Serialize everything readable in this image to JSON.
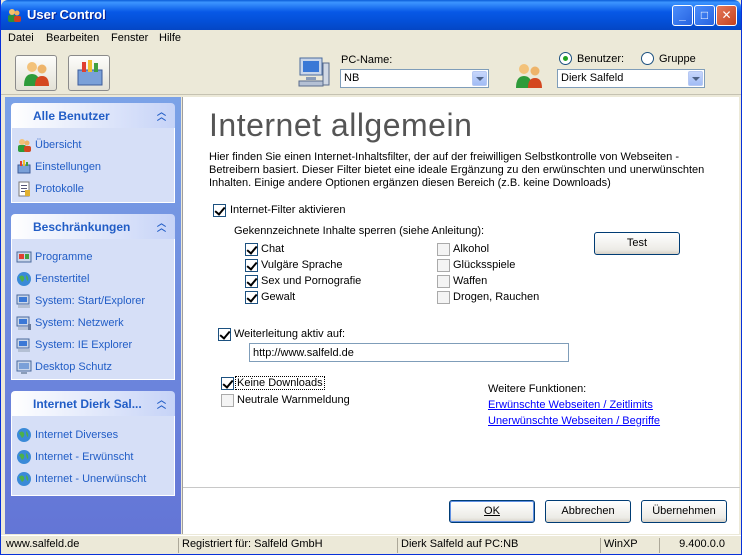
{
  "window": {
    "title": "User Control"
  },
  "menu": [
    "Datei",
    "Bearbeiten",
    "Fenster",
    "Hilfe"
  ],
  "toolbar": {
    "pc_label": "PC-Name:",
    "pc_value": "NB",
    "radio_user": "Benutzer:",
    "radio_group": "Gruppe",
    "user_value": "Dierk Salfeld"
  },
  "sidebar": {
    "sections": [
      {
        "title": "Alle Benutzer",
        "items": [
          "Übersicht",
          "Einstellungen",
          "Protokolle"
        ]
      },
      {
        "title": "Beschränkungen",
        "items": [
          "Programme",
          "Fenstertitel",
          "System: Start/Explorer",
          "System: Netzwerk",
          "System: IE Explorer",
          "Desktop Schutz"
        ]
      },
      {
        "title": "Internet Dierk Sal...",
        "items": [
          "Internet Diverses",
          "Internet - Erwünscht",
          "Internet - Unerwünscht"
        ]
      }
    ]
  },
  "main": {
    "heading": "Internet allgemein",
    "description": "Hier finden Sie einen Internet-Inhaltsfilter, der auf der freiwilligen Selbstkontrolle von Webseiten -Betreibern basiert. Dieser Filter bietet eine ideale Ergänzung zu den erwünschten und unerwünschten Inhalten. Einige andere Optionen ergänzen diesen Bereich (z.B. keine Downloads)",
    "filter_label": "Internet-Filter aktivieren",
    "block_label": "Gekennzeichnete Inhalte sperren (siehe Anleitung):",
    "test_button": "Test",
    "categories_left": [
      {
        "label": "Chat",
        "checked": true
      },
      {
        "label": "Vulgäre Sprache",
        "checked": true
      },
      {
        "label": "Sex und Pornografie",
        "checked": true
      },
      {
        "label": "Gewalt",
        "checked": true
      }
    ],
    "categories_right": [
      {
        "label": "Alkohol",
        "checked": false
      },
      {
        "label": "Glücksspiele",
        "checked": false
      },
      {
        "label": "Waffen",
        "checked": false
      },
      {
        "label": "Drogen, Rauchen",
        "checked": false
      }
    ],
    "redirect_label": "Weiterleitung aktiv auf:",
    "redirect_url": "http://www.salfeld.de",
    "no_downloads_label": "Keine Downloads",
    "neutral_warning_label": "Neutrale Warnmeldung",
    "more_functions_label": "Weitere Funktionen:",
    "link_wanted": "Erwünschte Webseiten / Zeitlimits",
    "link_unwanted": "Unerwünschte Webseiten / Begriffe",
    "ok_button": "OK",
    "cancel_button": "Abbrechen",
    "apply_button": "Übernehmen"
  },
  "status": {
    "site": "www.salfeld.de",
    "registered": "Registriert für: Salfeld GmbH",
    "user_pc": "Dierk Salfeld auf PC:NB",
    "os": "WinXP",
    "version": "9.400.0.0"
  }
}
